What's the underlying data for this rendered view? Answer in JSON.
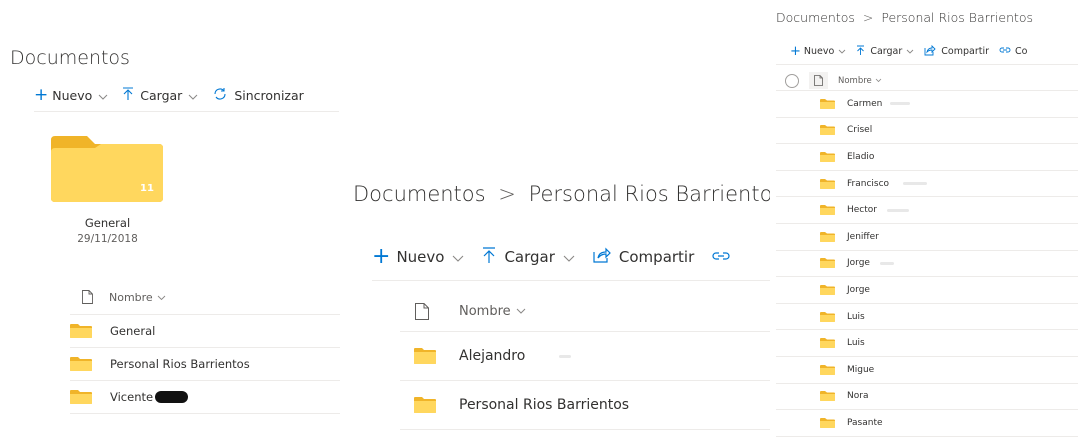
{
  "panel1": {
    "title": "Documentos",
    "toolbar": {
      "new_label": "Nuevo",
      "upload_label": "Cargar",
      "sync_label": "Sincronizar"
    },
    "tile": {
      "name": "General",
      "date": "29/11/2018",
      "count": "11"
    },
    "column_header": "Nombre",
    "rows": [
      {
        "name": "General"
      },
      {
        "name": "Personal Rios Barrientos"
      },
      {
        "name": "Vicente"
      }
    ]
  },
  "panel2": {
    "breadcrumb_root": "Documentos",
    "breadcrumb_separator": ">",
    "breadcrumb_current": "Personal Rios Barrientos",
    "toolbar": {
      "new_label": "Nuevo",
      "upload_label": "Cargar",
      "share_label": "Compartir"
    },
    "column_header": "Nombre",
    "rows": [
      {
        "name": "Alejandro"
      },
      {
        "name": "Personal Rios Barrientos"
      }
    ]
  },
  "panel3": {
    "breadcrumb_root": "Documentos",
    "breadcrumb_separator": ">",
    "breadcrumb_current": "Personal Rios Barrientos",
    "toolbar": {
      "new_label": "Nuevo",
      "upload_label": "Cargar",
      "share_label": "Compartir",
      "copy_label": "Co"
    },
    "column_header": "Nombre",
    "rows": [
      {
        "name": "Carmen"
      },
      {
        "name": "Crisel"
      },
      {
        "name": "Eladio"
      },
      {
        "name": "Francisco"
      },
      {
        "name": "Hector"
      },
      {
        "name": "Jeniffer"
      },
      {
        "name": "Jorge"
      },
      {
        "name": "Jorge"
      },
      {
        "name": "Luis"
      },
      {
        "name": "Luis"
      },
      {
        "name": "Migue"
      },
      {
        "name": "Nora"
      },
      {
        "name": "Pasante"
      }
    ]
  },
  "colors": {
    "accent": "#0078d4",
    "folder": "#ffd75e",
    "folder_dark": "#f0b429",
    "divider": "#edebe9"
  }
}
